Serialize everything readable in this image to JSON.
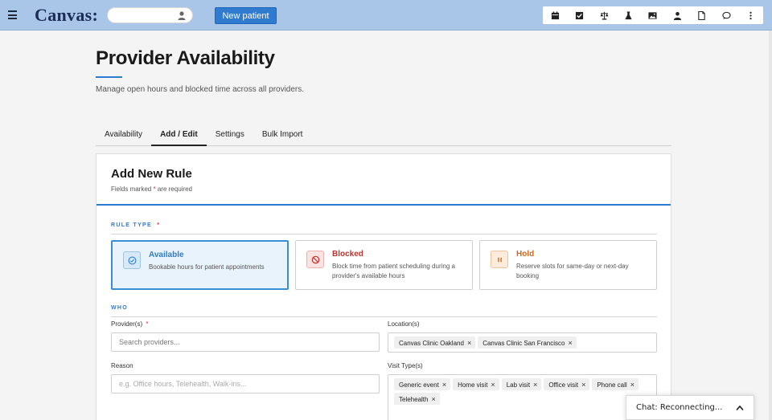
{
  "app": {
    "logo": "Canvas:"
  },
  "header": {
    "new_patient_label": "New patient",
    "toolbar_icons": [
      "calendar-icon",
      "checkbox-icon",
      "scales-icon",
      "flask-icon",
      "image-icon",
      "person-icon",
      "document-icon",
      "chat-bubble-icon",
      "more-vertical-icon"
    ]
  },
  "page": {
    "title": "Provider Availability",
    "subtitle": "Manage open hours and blocked time across all providers."
  },
  "tabs": [
    {
      "label": "Availability",
      "active": false
    },
    {
      "label": "Add / Edit",
      "active": true
    },
    {
      "label": "Settings",
      "active": false
    },
    {
      "label": "Bulk Import",
      "active": false
    }
  ],
  "form": {
    "title": "Add New Rule",
    "required_note_prefix": "Fields marked",
    "required_mark": "*",
    "required_note_suffix": "are required",
    "rule_type_label": "RULE TYPE",
    "rule_types": [
      {
        "title": "Available",
        "description": "Bookable hours for patient appointments",
        "color": "#2f7bd0",
        "selected": true
      },
      {
        "title": "Blocked",
        "description": "Block time from patient scheduling during a provider's available hours",
        "color": "#c0322b",
        "selected": false
      },
      {
        "title": "Hold",
        "description": "Reserve slots for same-day or next-day booking",
        "color": "#d0671c",
        "selected": false
      }
    ],
    "who_label": "WHO",
    "providers_label": "Provider(s)",
    "providers_placeholder": "Search providers...",
    "locations_label": "Location(s)",
    "locations": [
      "Canvas Clinic Oakland",
      "Canvas Clinic San Francisco"
    ],
    "reason_label": "Reason",
    "reason_placeholder": "e.g. Office hours, Telehealth, Walk-ins...",
    "visit_types_label": "Visit Type(s)",
    "visit_types": [
      "Generic event",
      "Home visit",
      "Lab visit",
      "Office visit",
      "Phone call",
      "Telehealth"
    ],
    "chip_remove_glyph": "×"
  },
  "chat": {
    "label": "Chat: Reconnecting..."
  },
  "colors": {
    "accent": "#2f7bd0",
    "topbar": "#a9c5e8",
    "required": "#d33"
  }
}
